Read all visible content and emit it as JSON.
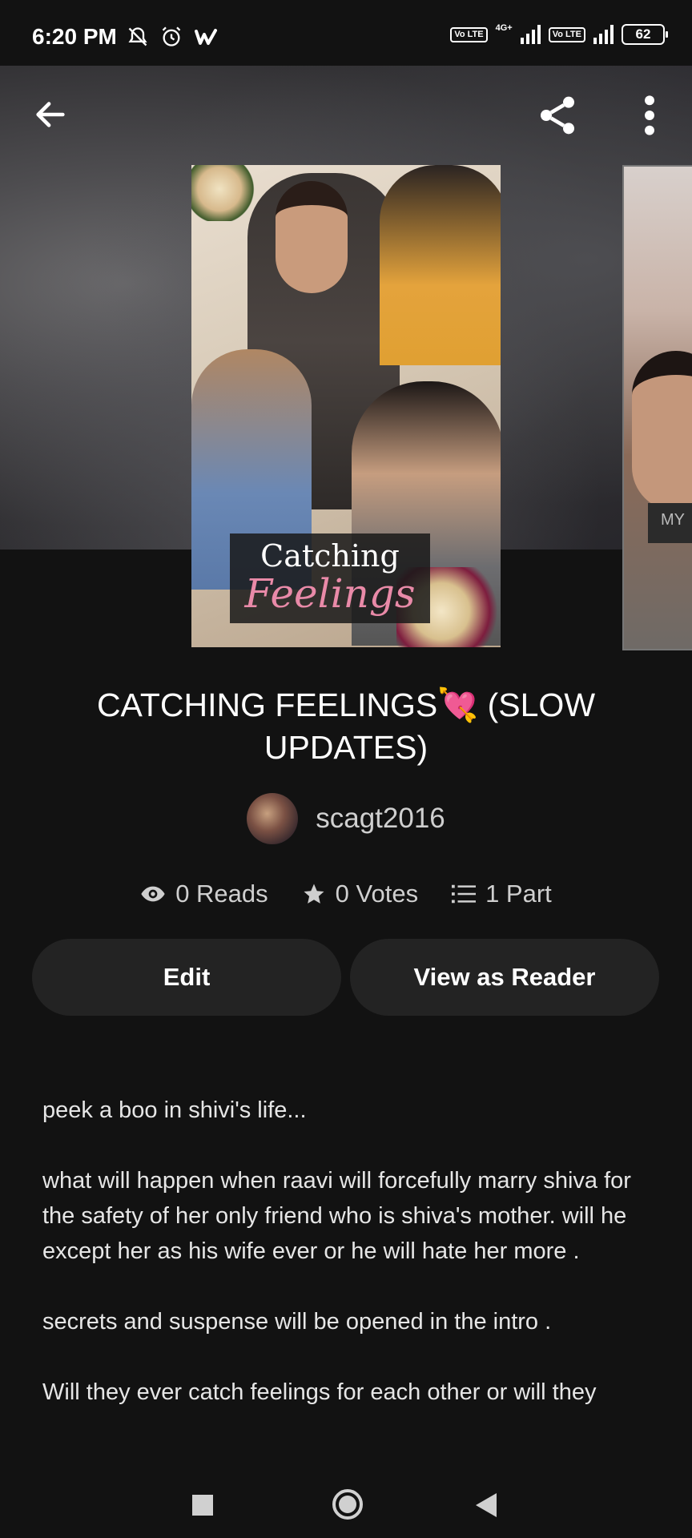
{
  "status_bar": {
    "time": "6:20 PM",
    "network_1": "4G+",
    "volte_1": "Vo LTE",
    "volte_2": "Vo LTE",
    "battery": "62"
  },
  "header": {
    "back_icon": "arrow-left-icon",
    "share_icon": "share-icon",
    "more_icon": "more-vertical-icon"
  },
  "cover": {
    "title_line1": "Catching",
    "title_line2": "Feelings"
  },
  "next_cover": {
    "label": "MY"
  },
  "story": {
    "title": "CATCHING FEELINGS💘 (SLOW UPDATES)",
    "author": "scagt2016",
    "reads": "0 Reads",
    "votes": "0 Votes",
    "parts": "1 Part"
  },
  "actions": {
    "edit_label": "Edit",
    "view_label": "View as Reader"
  },
  "description": [
    "peek a boo in shivi's life...",
    "what will happen when raavi will forcefully marry shiva for the safety of her only friend who is shiva's mother. will he except her as his wife ever or he will hate her more .",
    "secrets and suspense will be opened in the intro .",
    "Will they ever catch feelings for each other or will they"
  ],
  "nav": {
    "recents_icon": "square-icon",
    "home_icon": "circle-icon",
    "back_icon": "triangle-back-icon"
  }
}
